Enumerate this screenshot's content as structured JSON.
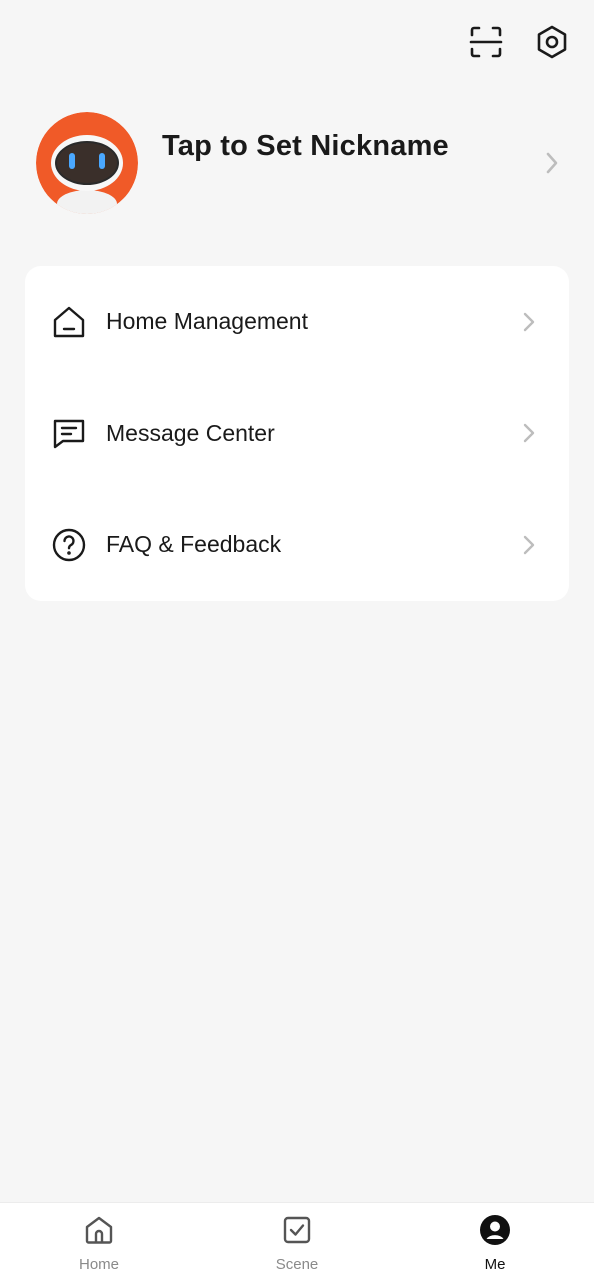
{
  "top_actions": {
    "scan_icon": "scan-icon",
    "settings_icon": "settings-hex-icon"
  },
  "profile": {
    "nickname": "Tap to Set Nickname",
    "avatar_icon": "robot-avatar",
    "accent_color": "#f05a28"
  },
  "menu": {
    "items": [
      {
        "label": "Home Management",
        "icon": "home-icon"
      },
      {
        "label": "Message Center",
        "icon": "message-icon"
      },
      {
        "label": "FAQ & Feedback",
        "icon": "question-icon"
      }
    ]
  },
  "tabbar": {
    "tabs": [
      {
        "label": "Home",
        "icon": "home-tab-icon",
        "active": false
      },
      {
        "label": "Scene",
        "icon": "scene-check-icon",
        "active": false
      },
      {
        "label": "Me",
        "icon": "person-icon",
        "active": true
      }
    ]
  }
}
